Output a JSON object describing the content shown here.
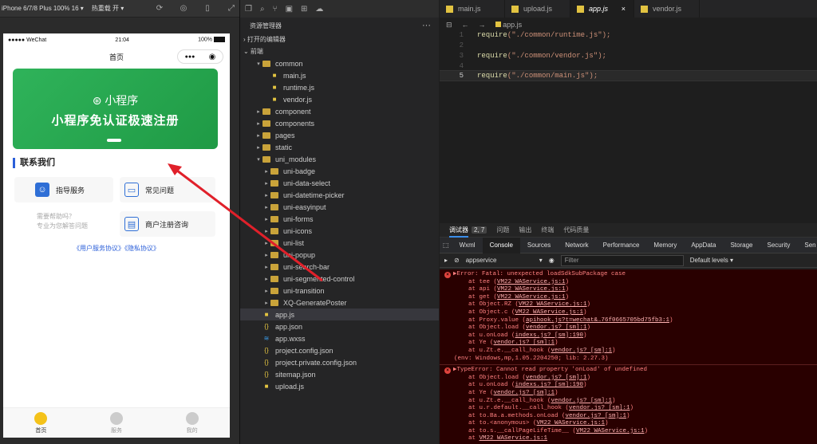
{
  "simulator": {
    "device": "iPhone 6/7/8 Plus 100% 16 ▾",
    "hot_reload": "热重载 开 ▾",
    "status": {
      "carrier": "●●●●● WeChat",
      "wifi": "wifi-icon",
      "time": "21:04",
      "battery": "100%"
    },
    "nav_title": "首页",
    "capsule": {
      "more": "●●●",
      "close": "◉"
    },
    "banner": {
      "brand": "小程序",
      "title": "小程序免认证极速注册"
    },
    "contact_title": "联系我们",
    "cards": [
      {
        "label": "指导服务",
        "icon": "service-avatar-icon",
        "color": "#2f6fd6"
      },
      {
        "label": "常见问题",
        "icon": "faq-icon",
        "color": "#2f6fd6"
      },
      {
        "label": "商户注册咨询",
        "icon": "register-icon",
        "color": "#2f6fd6"
      }
    ],
    "help": {
      "line1": "需要帮助吗？",
      "line2": "专业为您解答问题"
    },
    "links": "《用户服务协议》《隐私协议》",
    "tabbar": [
      {
        "label": "首页",
        "icon": "home-tab-icon",
        "active": true
      },
      {
        "label": "服务",
        "icon": "service-tab-icon",
        "active": false
      },
      {
        "label": "我的",
        "icon": "mine-tab-icon",
        "active": false
      }
    ]
  },
  "explorer": {
    "title": "资源管理器",
    "more": "···",
    "open_editors": "› 打开的编辑器",
    "project": "⌄ 前端",
    "tree": [
      {
        "label": "common",
        "type": "folder",
        "open": true,
        "indent": 1
      },
      {
        "label": "main.js",
        "type": "js",
        "indent": 2
      },
      {
        "label": "runtime.js",
        "type": "js",
        "indent": 2
      },
      {
        "label": "vendor.js",
        "type": "js",
        "indent": 2
      },
      {
        "label": "component",
        "type": "folder",
        "open": false,
        "indent": 1
      },
      {
        "label": "components",
        "type": "folder",
        "open": false,
        "indent": 1
      },
      {
        "label": "pages",
        "type": "folder",
        "open": false,
        "indent": 1
      },
      {
        "label": "static",
        "type": "folder",
        "open": false,
        "indent": 1
      },
      {
        "label": "uni_modules",
        "type": "folder",
        "open": true,
        "indent": 1
      },
      {
        "label": "uni-badge",
        "type": "folder",
        "open": false,
        "indent": 2
      },
      {
        "label": "uni-data-select",
        "type": "folder",
        "open": false,
        "indent": 2
      },
      {
        "label": "uni-datetime-picker",
        "type": "folder",
        "open": false,
        "indent": 2
      },
      {
        "label": "uni-easyinput",
        "type": "folder",
        "open": false,
        "indent": 2
      },
      {
        "label": "uni-forms",
        "type": "folder",
        "open": false,
        "indent": 2
      },
      {
        "label": "uni-icons",
        "type": "folder",
        "open": false,
        "indent": 2
      },
      {
        "label": "uni-list",
        "type": "folder",
        "open": false,
        "indent": 2
      },
      {
        "label": "uni-popup",
        "type": "folder",
        "open": false,
        "indent": 2
      },
      {
        "label": "uni-search-bar",
        "type": "folder",
        "open": false,
        "indent": 2
      },
      {
        "label": "uni-segmented-control",
        "type": "folder",
        "open": false,
        "indent": 2
      },
      {
        "label": "uni-transition",
        "type": "folder",
        "open": false,
        "indent": 2
      },
      {
        "label": "XQ-GeneratePoster",
        "type": "folder",
        "open": false,
        "indent": 2
      },
      {
        "label": "app.js",
        "type": "js",
        "indent": 1,
        "selected": true
      },
      {
        "label": "app.json",
        "type": "json",
        "indent": 1
      },
      {
        "label": "app.wxss",
        "type": "wxss",
        "indent": 1
      },
      {
        "label": "project.config.json",
        "type": "json",
        "indent": 1
      },
      {
        "label": "project.private.config.json",
        "type": "json",
        "indent": 1
      },
      {
        "label": "sitemap.json",
        "type": "json",
        "indent": 1
      },
      {
        "label": "upload.js",
        "type": "js",
        "indent": 1
      }
    ]
  },
  "editor": {
    "tabs": [
      {
        "label": "main.js",
        "active": false
      },
      {
        "label": "upload.js",
        "active": false
      },
      {
        "label": "app.js",
        "active": true,
        "close": "×"
      },
      {
        "label": "vendor.js",
        "active": false
      }
    ],
    "breadcrumb": "app.js",
    "lines": [
      {
        "no": "1",
        "fn": "require",
        "arg": "(\"./common/runtime.js\");"
      },
      {
        "no": "2",
        "fn": "",
        "arg": ""
      },
      {
        "no": "3",
        "fn": "require",
        "arg": "(\"./common/vendor.js\");"
      },
      {
        "no": "4",
        "fn": "",
        "arg": ""
      },
      {
        "no": "5",
        "fn": "require",
        "arg": "(\"./common/main.js\");"
      }
    ]
  },
  "debugger": {
    "panel_tabs": [
      "调试器",
      "问题",
      "输出",
      "终端",
      "代码质量"
    ],
    "badge": "2, 7",
    "devtools_tabs": [
      "Wxml",
      "Console",
      "Sources",
      "Network",
      "Performance",
      "Memory",
      "AppData",
      "Storage",
      "Security",
      "Sen"
    ],
    "context": "appservice",
    "filter_placeholder": "Filter",
    "levels": "Default levels ▾",
    "errors": [
      {
        "head": "▶Error: Fatal: unexpected loadSdkSubPackage case",
        "stack": [
          {
            "at": "at tee (",
            "link": "VM22 WAService.js:1",
            "end": ")"
          },
          {
            "at": "at api (",
            "link": "VM22 WAService.js:1",
            "end": ")"
          },
          {
            "at": "at get (",
            "link": "VM22 WAService.js:1",
            "end": ")"
          },
          {
            "at": "at Object.RZ (",
            "link": "VM22 WAService.js:1",
            "end": ")"
          },
          {
            "at": "at Object.c (",
            "link": "VM22 WAService.js:1",
            "end": ")"
          },
          {
            "at": "at Proxy.value (",
            "link": "apihook.js?t=wechat&…76f0665705bd75fb3:1",
            "end": ")"
          },
          {
            "at": "at Object.load (",
            "link": "vendor.js? [sm]:1",
            "end": ")"
          },
          {
            "at": "at u.onLoad (",
            "link": "indexs.js? [sm]:190",
            "end": ")"
          },
          {
            "at": "at Ye (",
            "link": "vendor.js? [sm]:1",
            "end": ")"
          },
          {
            "at": "at u.Zt.e.__call_hook (",
            "link": "vendor.js? [sm]:1",
            "end": ")"
          }
        ],
        "env": "(env: Windows,mp,1.05.2204250; lib: 2.27.3)"
      },
      {
        "head": "▶TypeError: Cannot read property 'onLoad' of undefined",
        "stack": [
          {
            "at": "at Object.load (",
            "link": "vendor.js? [sm]:1",
            "end": ")"
          },
          {
            "at": "at u.onLoad (",
            "link": "indexs.js? [sm]:190",
            "end": ")"
          },
          {
            "at": "at Ye (",
            "link": "vendor.js? [sm]:1",
            "end": ")"
          },
          {
            "at": "at u.Zt.e.__call_hook (",
            "link": "vendor.js? [sm]:1",
            "end": ")"
          },
          {
            "at": "at u.r.default.__call_hook (",
            "link": "vendor.js? [sm]:1",
            "end": ")"
          },
          {
            "at": "at to.Ba.a.methods.onLoad (",
            "link": "vendor.js? [sm]:1",
            "end": ")"
          },
          {
            "at": "at to.<anonymous> (",
            "link": "VM22 WAService.js:1",
            "end": ")"
          },
          {
            "at": "at to.s.__callPageLifeTime__ (",
            "link": "VM22 WAService.js:1",
            "end": ")"
          },
          {
            "at": "at ",
            "link": "VM22 WAService.js:1",
            "end": ""
          }
        ],
        "env": ""
      }
    ]
  }
}
